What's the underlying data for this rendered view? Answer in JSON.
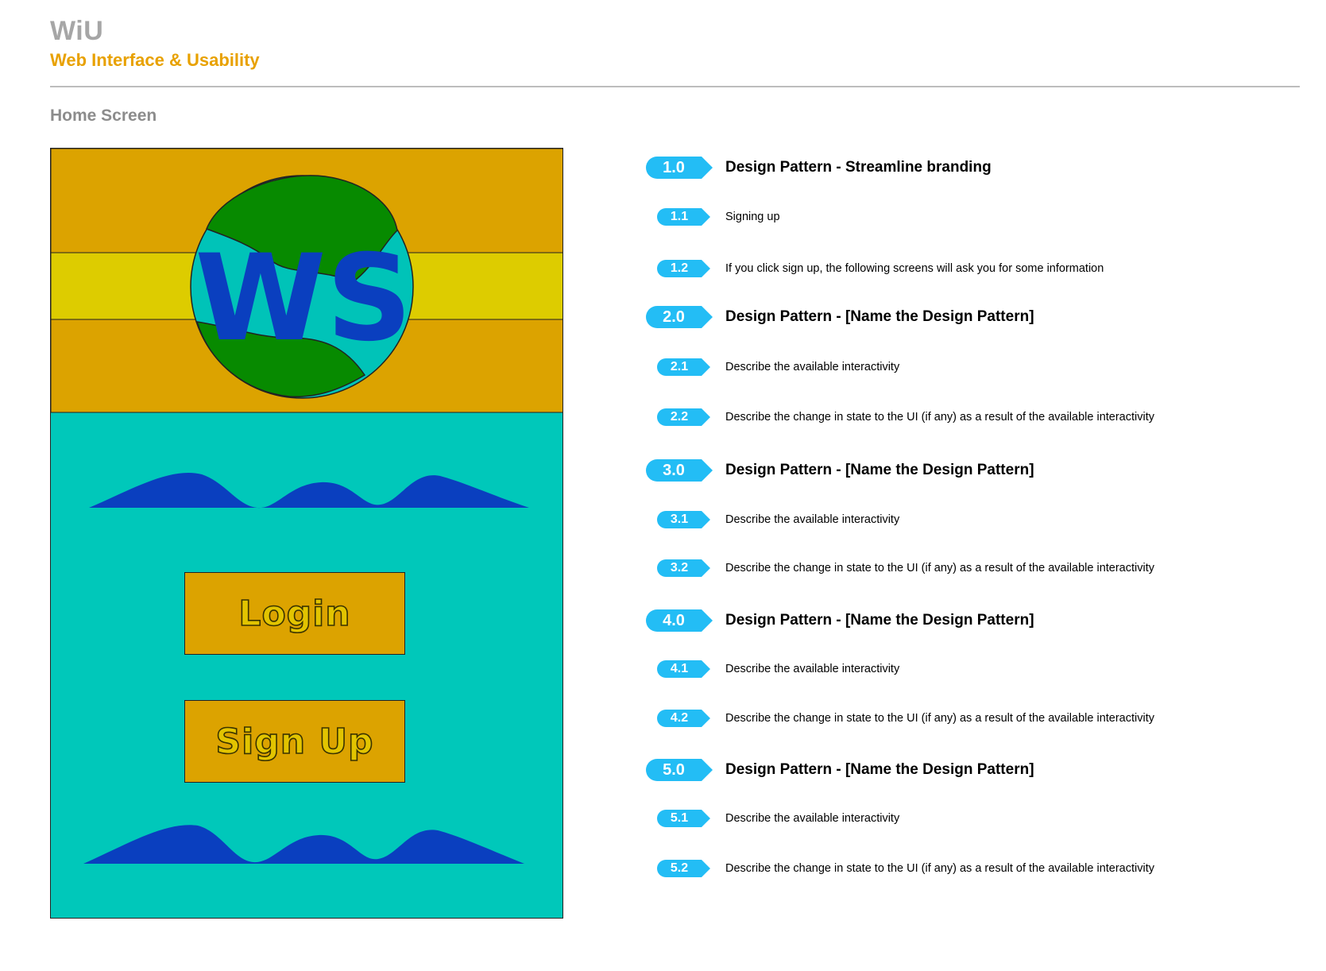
{
  "header": {
    "title": "WiU",
    "subtitle": "Web Interface & Usability",
    "screen_label": "Home Screen"
  },
  "mockup": {
    "logo_text": "WS",
    "login_label": "Login",
    "signup_label": "Sign Up"
  },
  "annotations": [
    {
      "num": "1.0",
      "text": "Design Pattern - Streamline branding",
      "level": "major"
    },
    {
      "num": "1.1",
      "text": "Signing up",
      "level": "minor"
    },
    {
      "num": "1.2",
      "text": "If you click sign up, the following screens will ask you for some information",
      "level": "minor"
    },
    {
      "num": "2.0",
      "text": "Design Pattern - [Name the Design Pattern]",
      "level": "major"
    },
    {
      "num": "2.1",
      "text": "Describe the available interactivity",
      "level": "minor"
    },
    {
      "num": "2.2",
      "text": "Describe the change in state to the UI (if any) as a result of the available interactivity",
      "level": "minor"
    },
    {
      "num": "3.0",
      "text": "Design Pattern - [Name the Design Pattern]",
      "level": "major"
    },
    {
      "num": "3.1",
      "text": "Describe the available interactivity",
      "level": "minor"
    },
    {
      "num": "3.2",
      "text": "Describe the change in state to the UI (if any) as a result of the available interactivity",
      "level": "minor"
    },
    {
      "num": "4.0",
      "text": "Design Pattern - [Name the Design Pattern]",
      "level": "major"
    },
    {
      "num": "4.1",
      "text": "Describe the available interactivity",
      "level": "minor"
    },
    {
      "num": "4.2",
      "text": "Describe the change in state to the UI (if any) as a result of the available interactivity",
      "level": "minor"
    },
    {
      "num": "5.0",
      "text": "Design Pattern - [Name the Design Pattern]",
      "level": "major"
    },
    {
      "num": "5.1",
      "text": "Describe the available interactivity",
      "level": "minor"
    },
    {
      "num": "5.2",
      "text": "Describe the change in state to the UI (if any) as a result of the available interactivity",
      "level": "minor"
    }
  ],
  "colors": {
    "brand_gray": "#a6a6a6",
    "brand_orange": "#e8a100",
    "badge_blue": "#23bdf5",
    "mock_teal": "#00c8ba",
    "mock_gold": "#dca300",
    "mock_yellow": "#ddcc00",
    "logo_green": "#078a00",
    "logo_blue": "#0a3fbf"
  }
}
